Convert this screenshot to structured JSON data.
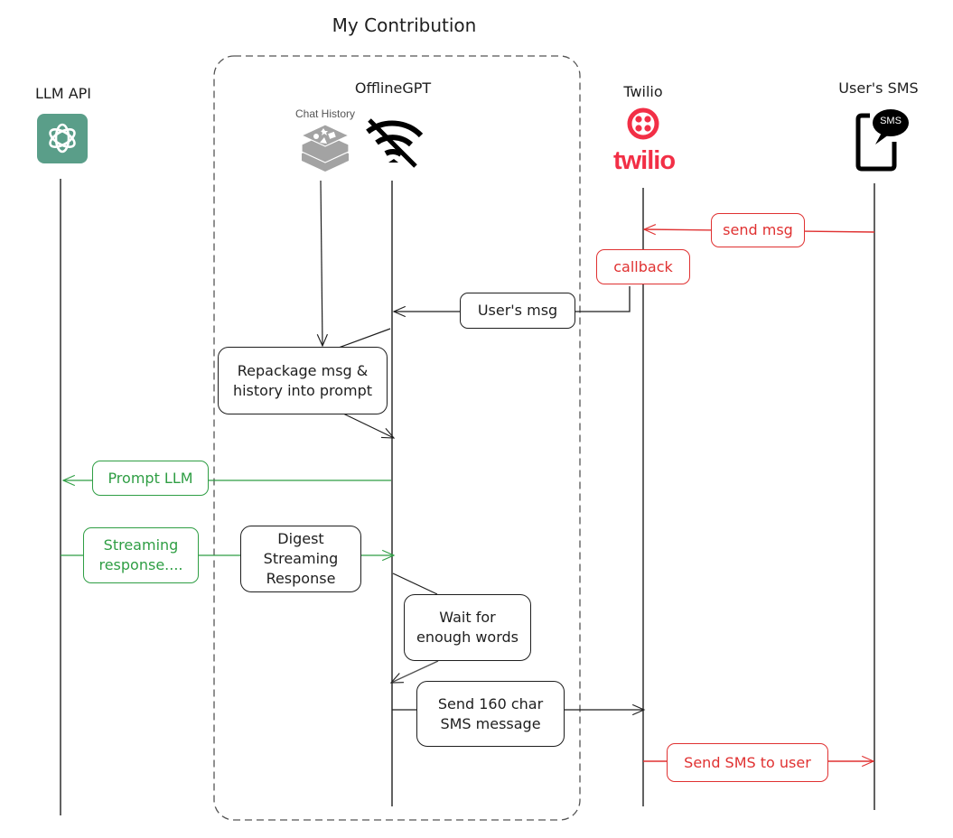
{
  "title": "My Contribution",
  "colors": {
    "ink": "#1e1e1e",
    "red": "#e03131",
    "green": "#2f9e44",
    "openai_green": "#5a9e89",
    "twilio_red": "#f22f46",
    "redis_gray": "#a3a3a3",
    "frame_dash": "#555555"
  },
  "group": {
    "label": "My Contribution"
  },
  "actors": [
    {
      "id": "llm",
      "label": "LLM API",
      "icon": "openai-logo-icon"
    },
    {
      "id": "offlinegpt",
      "label": "OfflineGPT",
      "icon": "wifi-off-icon"
    },
    {
      "id": "twilio",
      "label": "Twilio",
      "icon": "twilio-logo-icon",
      "wordmark": "twilio"
    },
    {
      "id": "user",
      "label": "User's SMS",
      "icon": "sms-phone-icon",
      "icon_text": "SMS"
    }
  ],
  "chat_history": {
    "label": "Chat History",
    "icon": "redis-database-icon"
  },
  "messages": [
    {
      "id": "send-msg",
      "text": "send msg",
      "from": "user",
      "to": "twilio",
      "color": "red"
    },
    {
      "id": "callback",
      "text": "callback",
      "from": "twilio",
      "to": "offlinegpt",
      "color": "red"
    },
    {
      "id": "users-msg",
      "text": "User's msg",
      "from": "twilio",
      "to": "offlinegpt",
      "color": "ink"
    },
    {
      "id": "repackage",
      "text": "Repackage msg &\nhistory into prompt",
      "from": "offlinegpt",
      "to": "offlinegpt",
      "color": "ink"
    },
    {
      "id": "prompt-llm",
      "text": "Prompt LLM",
      "from": "offlinegpt",
      "to": "llm",
      "color": "green"
    },
    {
      "id": "streaming",
      "text": "Streaming\nresponse....",
      "from": "llm",
      "to": "offlinegpt",
      "color": "green"
    },
    {
      "id": "digest",
      "text": "Digest\nStreaming\nResponse",
      "from": "llm",
      "to": "offlinegpt",
      "color": "ink"
    },
    {
      "id": "wait",
      "text": "Wait for\nenough words",
      "from": "offlinegpt",
      "to": "offlinegpt",
      "color": "ink"
    },
    {
      "id": "send160",
      "text": "Send 160 char\nSMS message",
      "from": "offlinegpt",
      "to": "twilio",
      "color": "ink"
    },
    {
      "id": "send-sms",
      "text": "Send SMS to user",
      "from": "twilio",
      "to": "user",
      "color": "red"
    }
  ]
}
